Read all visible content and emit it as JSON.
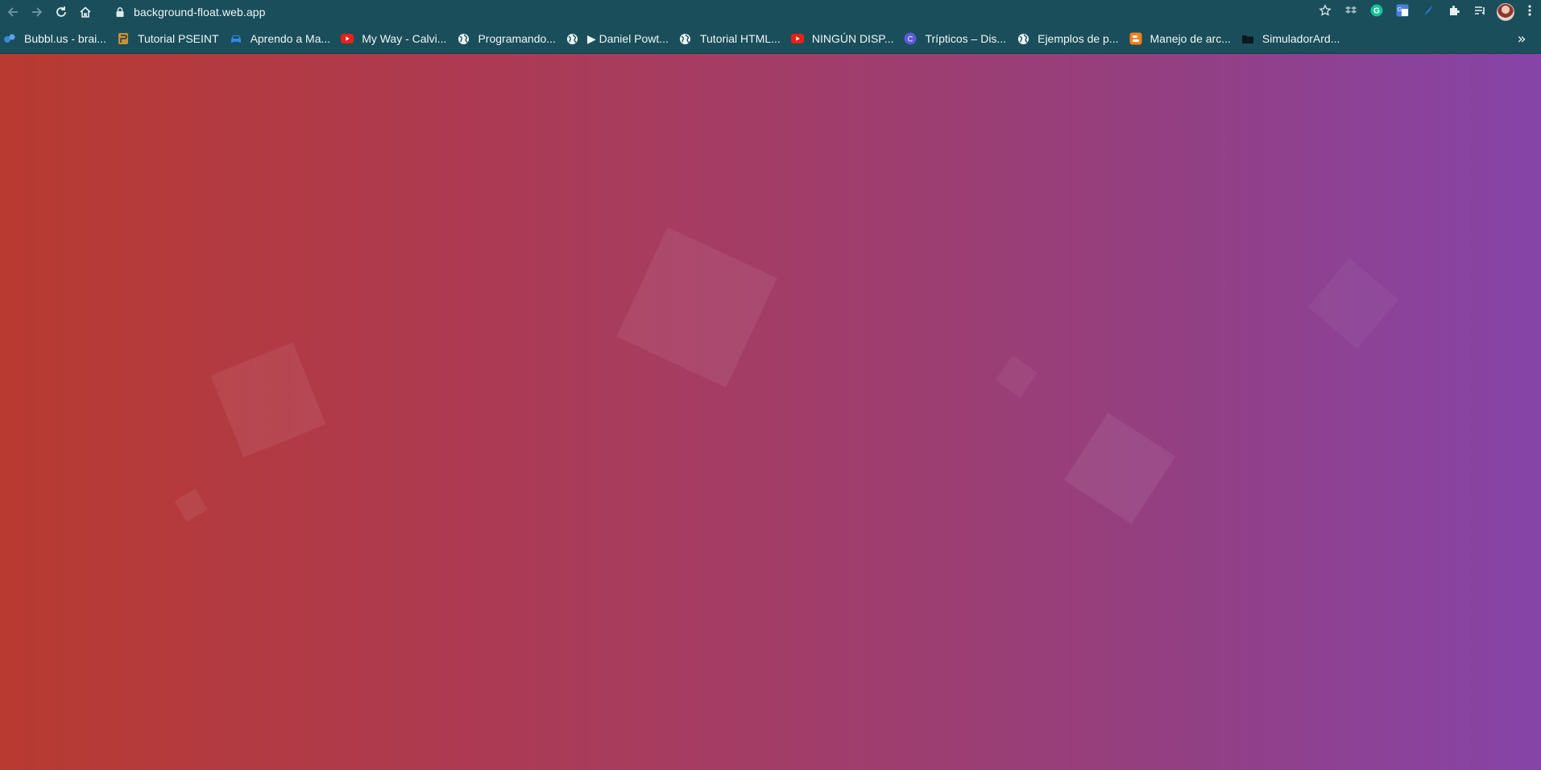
{
  "browser": {
    "url": "background-float.web.app",
    "bookmarks": [
      {
        "label": "Bubbl.us - brai...",
        "icon": "bubbl-icon"
      },
      {
        "label": "Tutorial PSEINT",
        "icon": "pseint-icon"
      },
      {
        "label": "Aprendo a Ma...",
        "icon": "car-icon"
      },
      {
        "label": "My Way - Calvi...",
        "icon": "youtube-icon"
      },
      {
        "label": "Programando...",
        "icon": "globe-icon"
      },
      {
        "label": "▶ Daniel Powt...",
        "icon": "globe-icon"
      },
      {
        "label": "Tutorial HTML...",
        "icon": "globe-icon"
      },
      {
        "label": "NINGÚN DISP...",
        "icon": "youtube-icon"
      },
      {
        "label": "Trípticos – Dis...",
        "icon": "canva-icon"
      },
      {
        "label": "Ejemplos de p...",
        "icon": "globe-icon"
      },
      {
        "label": "Manejo de arc...",
        "icon": "blogger-icon"
      },
      {
        "label": "SimuladorArd...",
        "icon": "folder-icon"
      }
    ],
    "more_bookmarks": "»"
  },
  "colors": {
    "chrome": "#1a4e5a",
    "gradient_start": "#b83a30",
    "gradient_end": "#8644a8"
  }
}
